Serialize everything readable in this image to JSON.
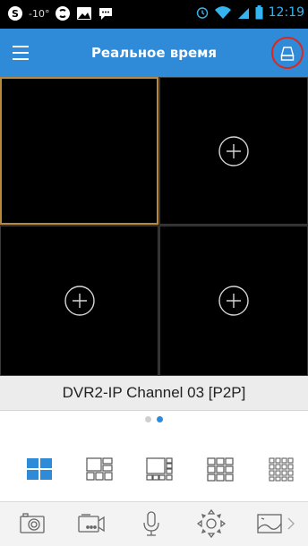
{
  "status_bar": {
    "temperature": "-10°",
    "time": "12:19"
  },
  "app_bar": {
    "title": "Реальное время",
    "menu_icon": "hamburger-menu-icon",
    "action_icon": "storage-drive-icon"
  },
  "video_grid": {
    "cells": [
      {
        "state": "selected",
        "content": "empty"
      },
      {
        "state": "normal",
        "content": "add"
      },
      {
        "state": "normal",
        "content": "add"
      },
      {
        "state": "normal",
        "content": "add"
      }
    ]
  },
  "channel": {
    "name": "DVR2-IP Channel 03 [P2P]"
  },
  "pager": {
    "page_count": 2,
    "active_page": 2
  },
  "layouts": {
    "selected": "4-split",
    "options": [
      "4-split",
      "6-split",
      "8-split",
      "9-split",
      "16-split"
    ]
  },
  "toolbar": {
    "items": [
      "snapshot-icon",
      "record-icon",
      "microphone-icon",
      "ptz-icon",
      "image-settings-icon",
      "chevron-right-icon"
    ]
  },
  "colors": {
    "accent": "#2f8ad8",
    "selected_border": "#b8893a",
    "status_time": "#35b5f0"
  }
}
